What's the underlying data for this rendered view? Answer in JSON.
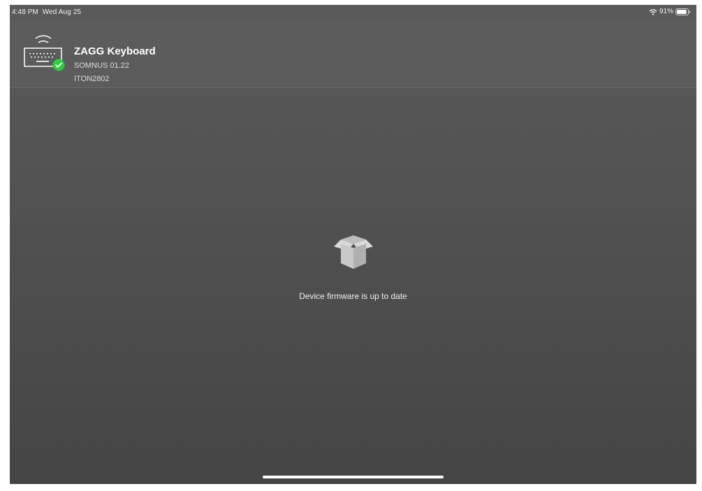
{
  "status_bar": {
    "time": "4:48 PM",
    "date": "Wed Aug 25",
    "battery": "91%",
    "battery_level": 0.91
  },
  "device": {
    "name": "ZAGG Keyboard",
    "firmware": "SOMNUS 01.22",
    "id": "ITON2802",
    "status": "connected",
    "status_color": "#2ecc40"
  },
  "main": {
    "message": "Device firmware is up to date"
  },
  "icons": {
    "wifi": "wifi-icon",
    "battery": "battery-icon",
    "keyboard": "keyboard-icon",
    "connected": "checkmark-badge-icon",
    "open_box": "open-box-icon"
  }
}
